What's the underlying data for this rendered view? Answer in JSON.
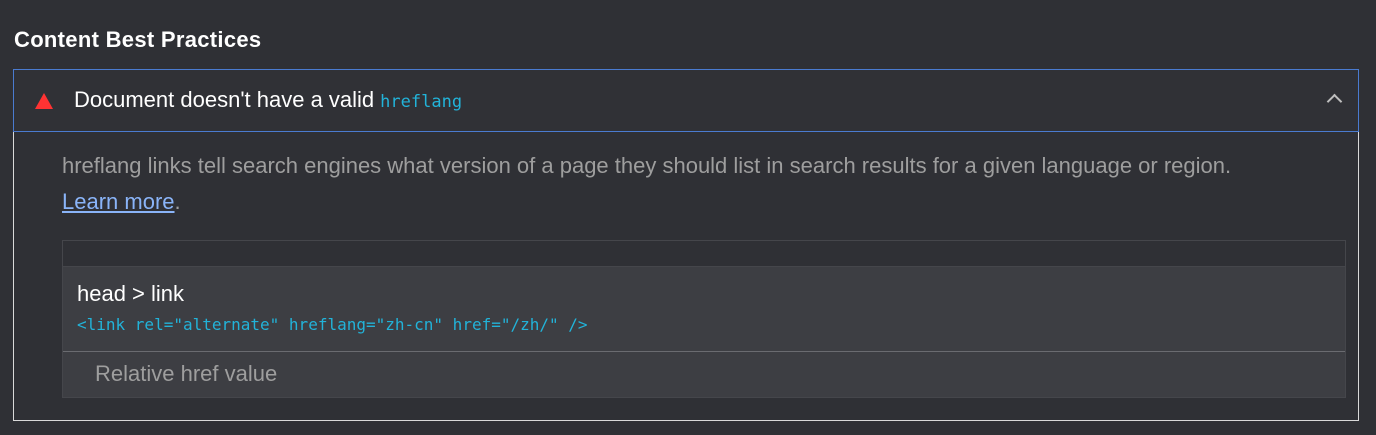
{
  "group": {
    "title": "Content Best Practices"
  },
  "audit": {
    "title": "Document doesn't have a valid",
    "title_code": "hreflang",
    "description": "hreflang links tell search engines what version of a page they should list in search results for a given language or region.",
    "learn_more": "Learn more",
    "description_end": ".",
    "status_color": "#ff3333",
    "code_color": "#22b3d9",
    "link_color": "#8ab4f8",
    "icons": {
      "status": "warning-triangle-icon",
      "toggle": "chevron-up-icon"
    },
    "details": {
      "items": [
        {
          "node_label": "head > link",
          "snippet": "<link rel=\"alternate\" hreflang=\"zh-cn\" href=\"/zh/\" />",
          "sub_item": "Relative href value"
        }
      ]
    }
  }
}
